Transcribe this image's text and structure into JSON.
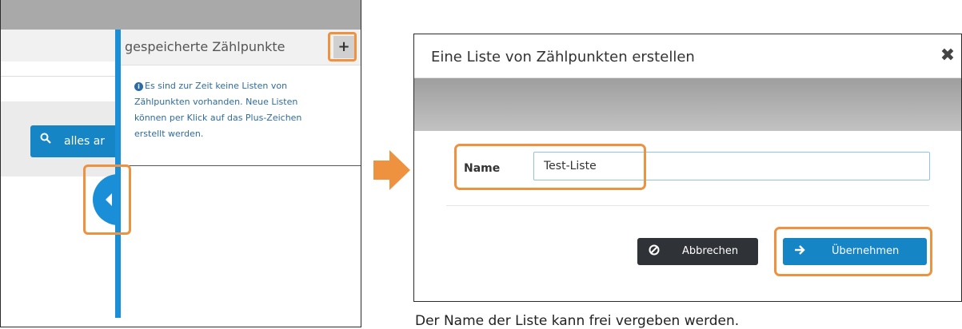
{
  "left_panel": {
    "search_button_label": "alles ar",
    "search_icon": "search-icon",
    "side_panel_title": "gespeicherte Zählpunkte",
    "plus_symbol": "+",
    "info_icon": "info-icon",
    "info_text": "Es sind zur Zeit keine Listen von Zählpunkten vorhanden. Neue Listen können per Klick auf das Plus-Zeichen erstellt werden.",
    "toggle_icon": "chevron-left-icon"
  },
  "dialog": {
    "title": "Eine Liste von Zählpunkten erstellen",
    "close_icon": "close-icon",
    "name_label": "Name",
    "name_value": "Test-Liste",
    "cancel_label": "Abbrechen",
    "cancel_icon": "ban-icon",
    "ok_label": "Übernehmen",
    "ok_icon": "arrow-right-icon"
  },
  "caption": "Der Name der Liste kann frei vergeben werden.",
  "colors": {
    "accent_blue": "#1a8fd8",
    "highlight_orange": "#ee9240",
    "dark_button": "#2f3237"
  }
}
